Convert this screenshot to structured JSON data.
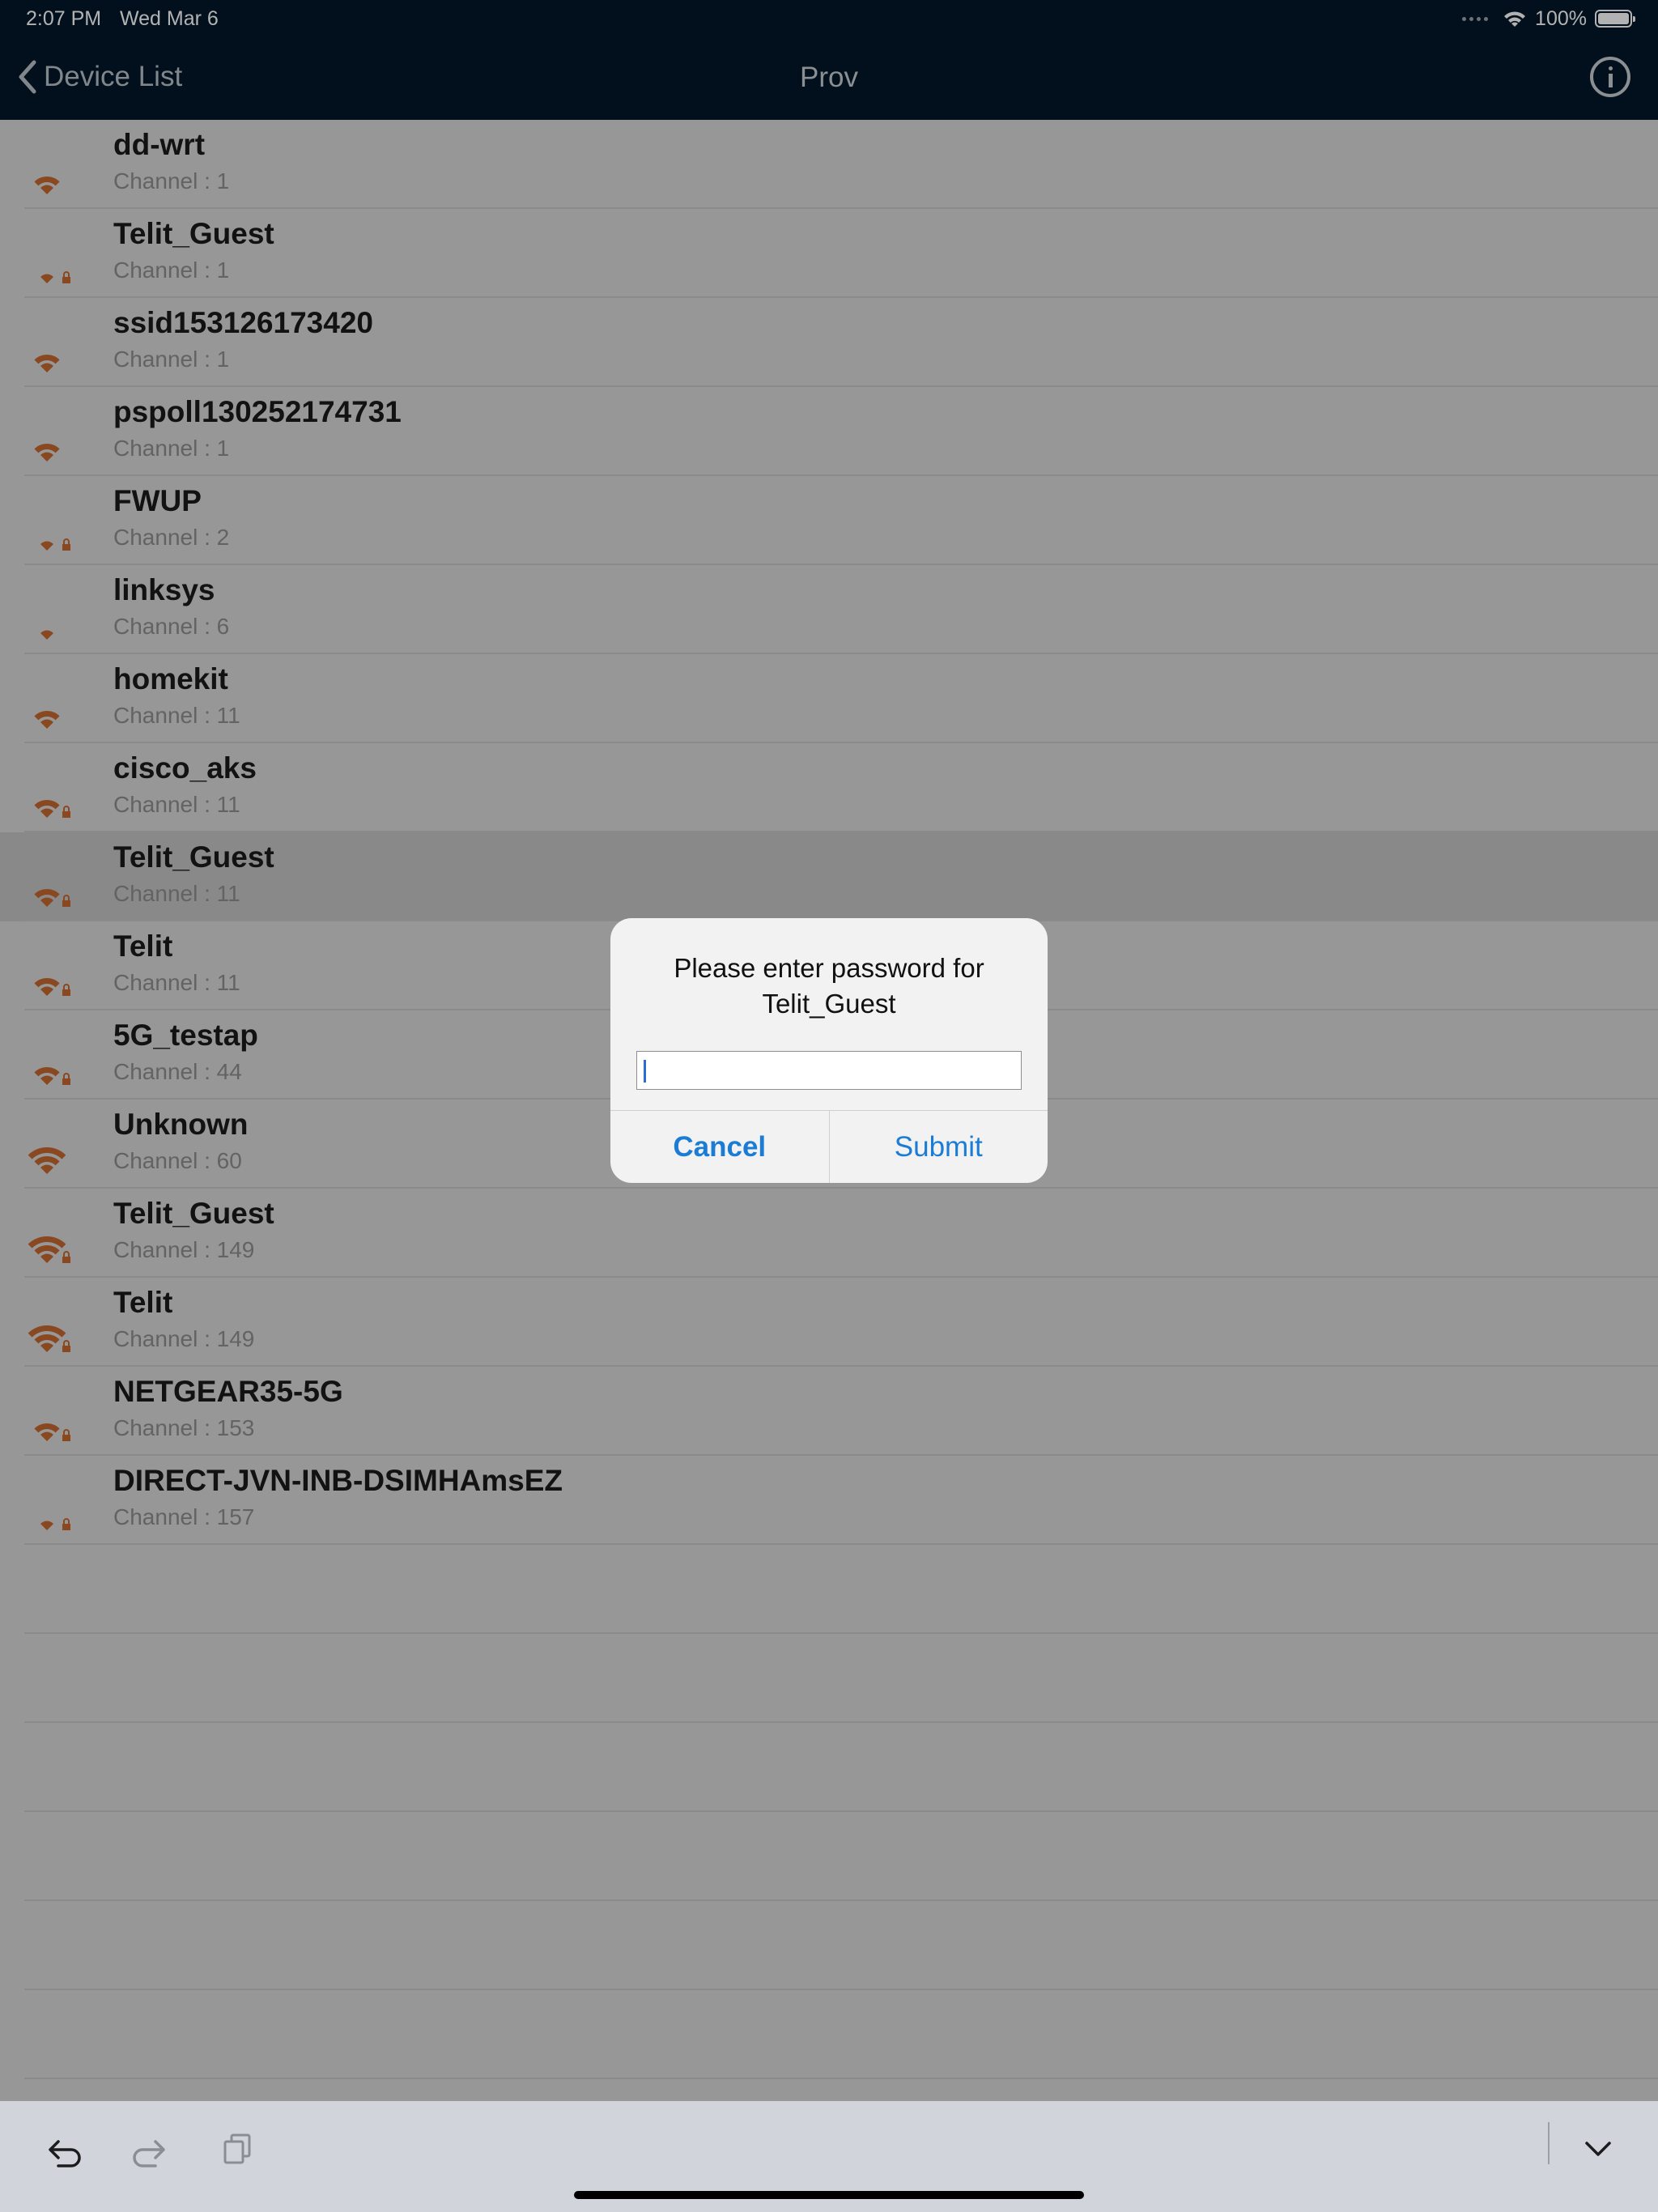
{
  "status": {
    "time": "2:07 PM",
    "date": "Wed Mar 6",
    "battery": "100%",
    "battery_level": 1.0
  },
  "nav": {
    "back_label": "Device List",
    "title": "Prov"
  },
  "wifi_color": "#c5672f",
  "networks": [
    {
      "ssid": "dd-wrt",
      "channel": "Channel : 1",
      "bars": 2,
      "locked": false
    },
    {
      "ssid": "Telit_Guest",
      "channel": "Channel : 1",
      "bars": 1,
      "locked": true
    },
    {
      "ssid": "ssid153126173420",
      "channel": "Channel : 1",
      "bars": 2,
      "locked": false
    },
    {
      "ssid": "pspoll130252174731",
      "channel": "Channel : 1",
      "bars": 2,
      "locked": false
    },
    {
      "ssid": "FWUP",
      "channel": "Channel : 2",
      "bars": 1,
      "locked": true
    },
    {
      "ssid": "linksys",
      "channel": "Channel : 6",
      "bars": 1,
      "locked": false
    },
    {
      "ssid": "homekit",
      "channel": "Channel : 11",
      "bars": 2,
      "locked": false
    },
    {
      "ssid": "cisco_aks",
      "channel": "Channel : 11",
      "bars": 2,
      "locked": true
    },
    {
      "ssid": "Telit_Guest",
      "channel": "Channel : 11",
      "bars": 2,
      "locked": true,
      "selected": true
    },
    {
      "ssid": "Telit",
      "channel": "Channel : 11",
      "bars": 2,
      "locked": true
    },
    {
      "ssid": "5G_testap",
      "channel": "Channel : 44",
      "bars": 2,
      "locked": true
    },
    {
      "ssid": "Unknown",
      "channel": "Channel : 60",
      "bars": 3,
      "locked": false
    },
    {
      "ssid": "Telit_Guest",
      "channel": "Channel : 149",
      "bars": 3,
      "locked": true
    },
    {
      "ssid": "Telit",
      "channel": "Channel : 149",
      "bars": 3,
      "locked": true
    },
    {
      "ssid": "NETGEAR35-5G",
      "channel": "Channel : 153",
      "bars": 2,
      "locked": true
    },
    {
      "ssid": "DIRECT-JVN-INB-DSIMHAmsEZ",
      "channel": "Channel : 157",
      "bars": 1,
      "locked": true
    }
  ],
  "empty_rows": 6,
  "alert": {
    "title_line1": "Please enter password for",
    "title_line2": "Telit_Guest",
    "input_value": "",
    "cancel": "Cancel",
    "submit": "Submit"
  },
  "toolbar": {
    "icons": [
      "undo-icon",
      "redo-icon",
      "paste-icon",
      "chevron-down-icon"
    ]
  }
}
